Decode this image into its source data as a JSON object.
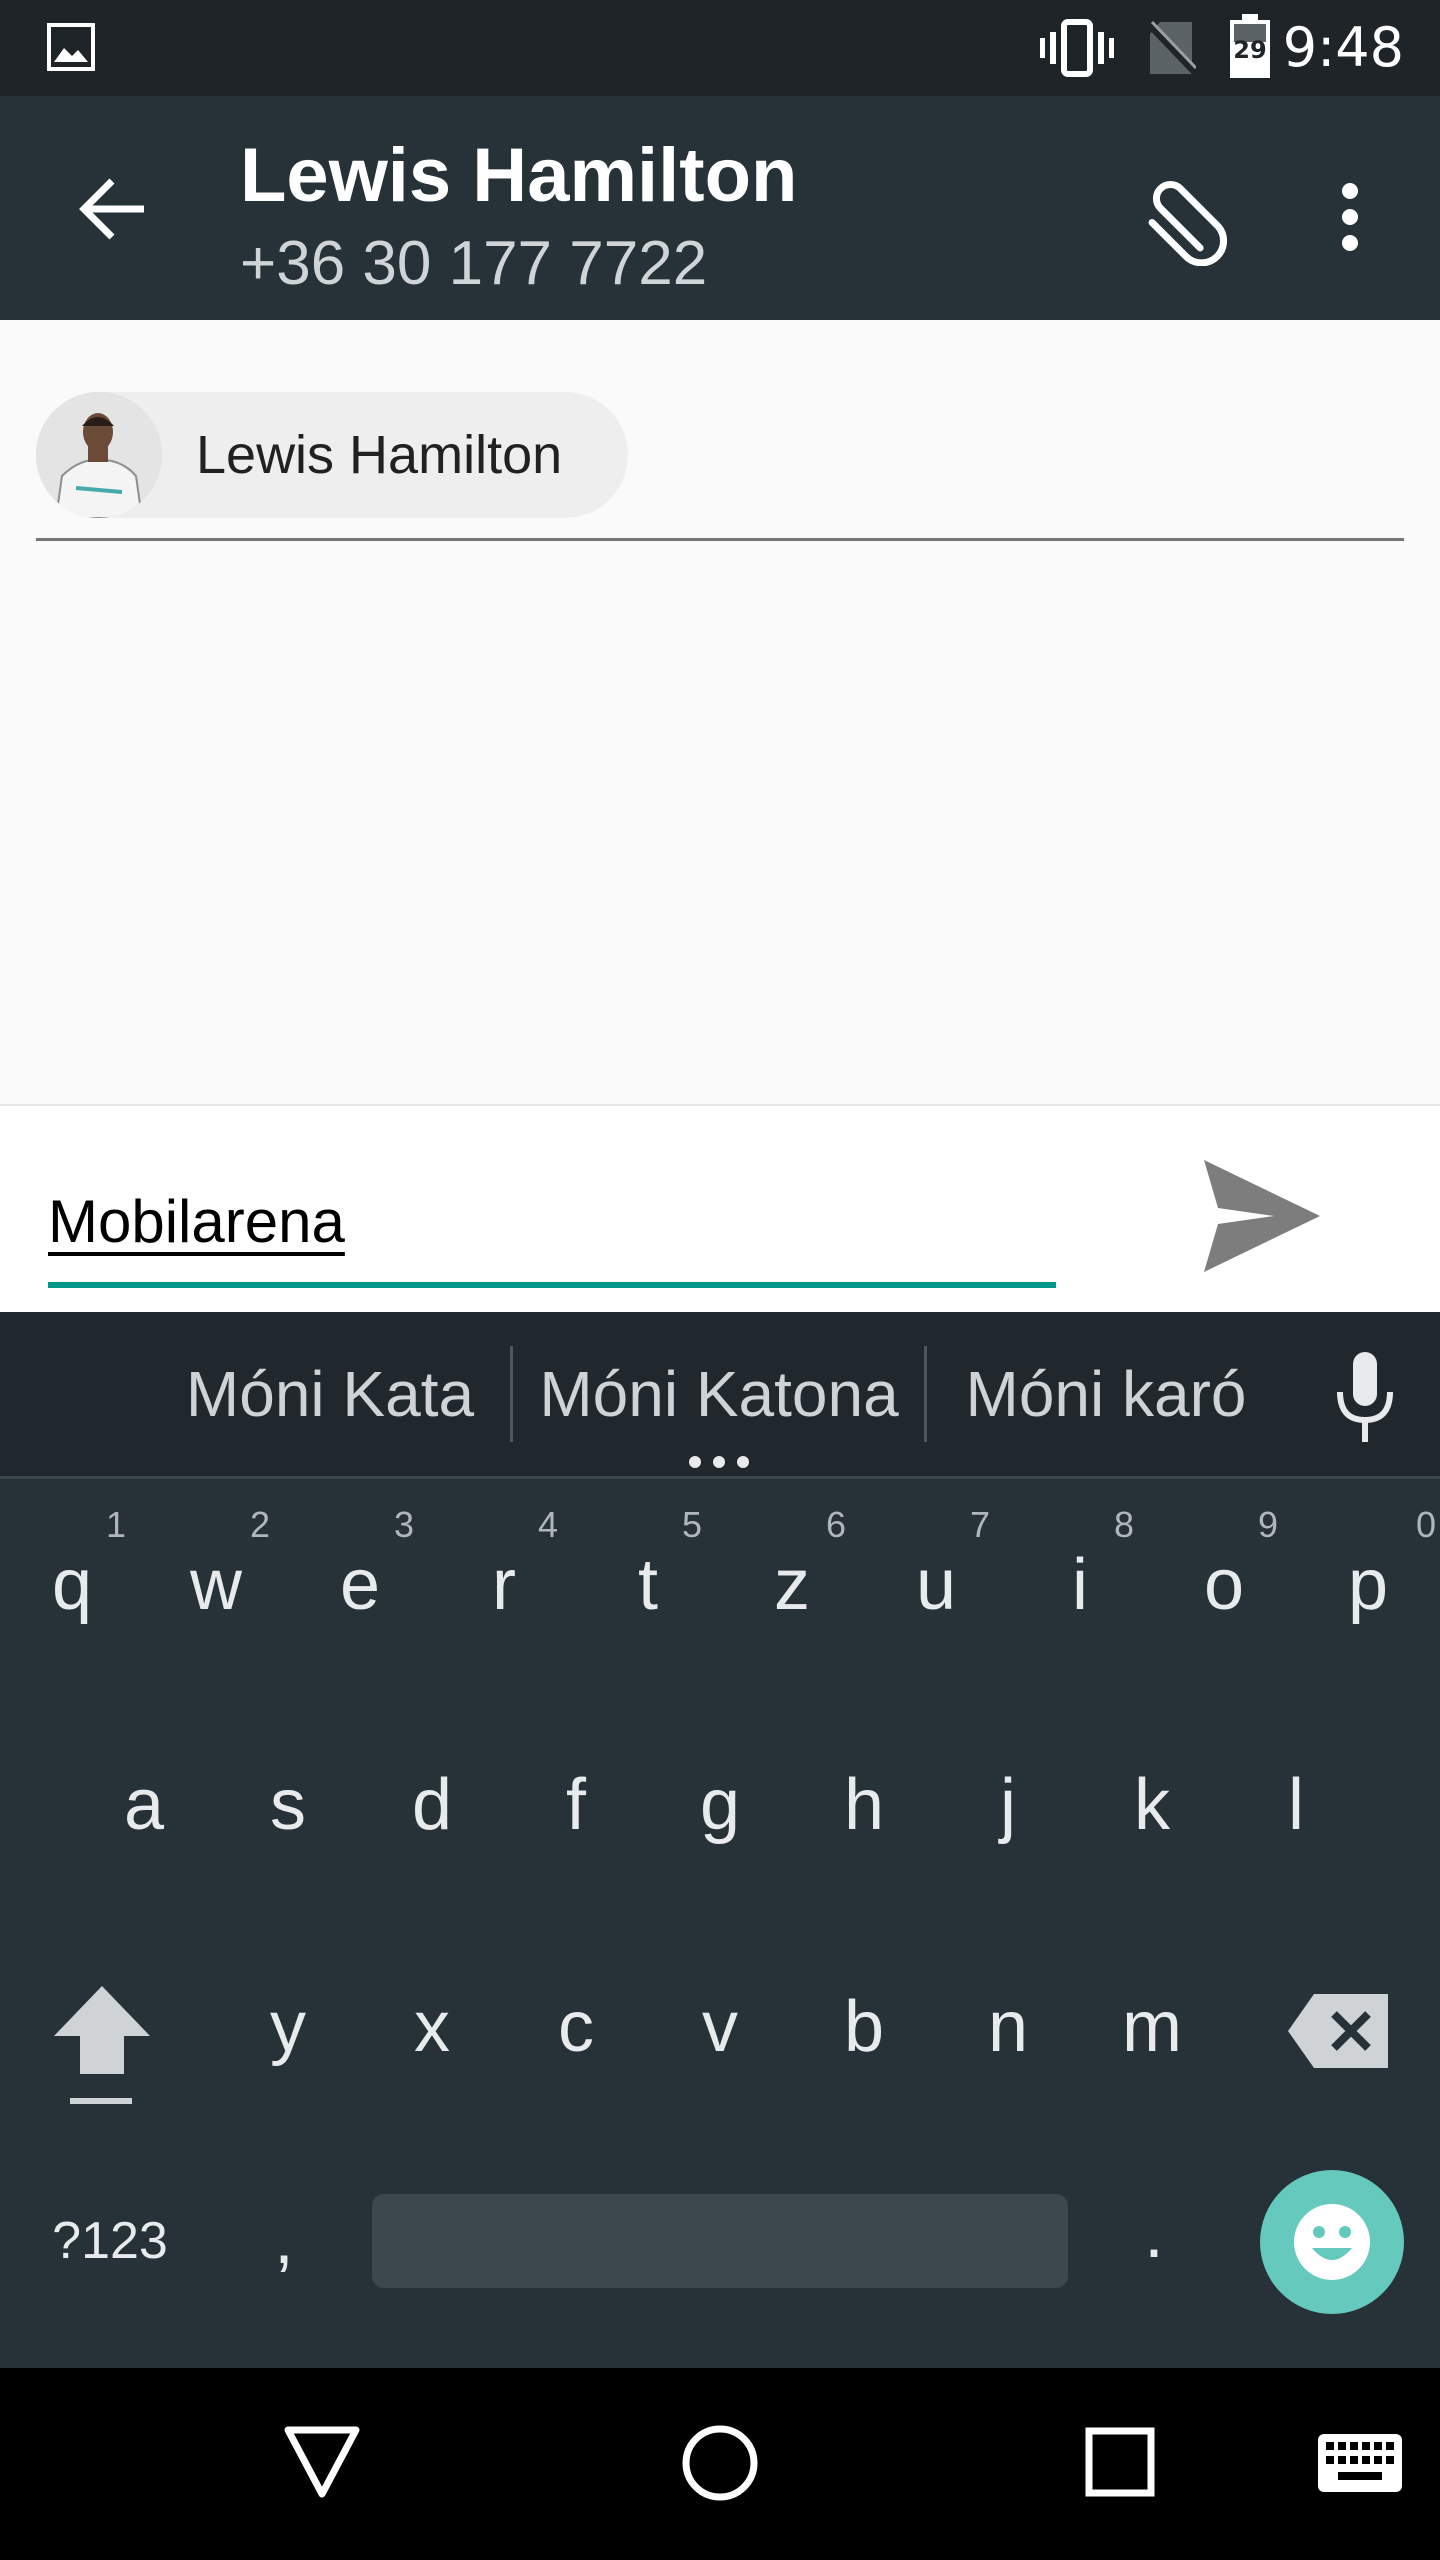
{
  "status_bar": {
    "time": "9:48",
    "battery_level": "29"
  },
  "app_bar": {
    "title": "Lewis Hamilton",
    "subtitle": "+36 30 177 7722",
    "icons": [
      "back-arrow-icon",
      "paperclip-icon",
      "more-vert-icon"
    ]
  },
  "recipient": {
    "chip_name": "Lewis Hamilton"
  },
  "compose": {
    "message": "Mobilarena",
    "send_icon": "send-icon"
  },
  "keyboard": {
    "suggestions": [
      "Móni Kata",
      "Móni Katona",
      "Móni karó"
    ],
    "row1": [
      {
        "key": "q",
        "hint": "1"
      },
      {
        "key": "w",
        "hint": "2"
      },
      {
        "key": "e",
        "hint": "3"
      },
      {
        "key": "r",
        "hint": "4"
      },
      {
        "key": "t",
        "hint": "5"
      },
      {
        "key": "z",
        "hint": "6"
      },
      {
        "key": "u",
        "hint": "7"
      },
      {
        "key": "i",
        "hint": "8"
      },
      {
        "key": "o",
        "hint": "9"
      },
      {
        "key": "p",
        "hint": "0"
      }
    ],
    "row2": [
      "a",
      "s",
      "d",
      "f",
      "g",
      "h",
      "j",
      "k",
      "l"
    ],
    "row3": [
      "y",
      "x",
      "c",
      "v",
      "b",
      "n",
      "m"
    ],
    "symbols_label": "?123",
    "comma": ",",
    "period": "."
  },
  "colors": {
    "accent": "#009688",
    "app_bar": "#263238",
    "keyboard_bg": "#263238",
    "emoji_key": "#66c9bd"
  }
}
